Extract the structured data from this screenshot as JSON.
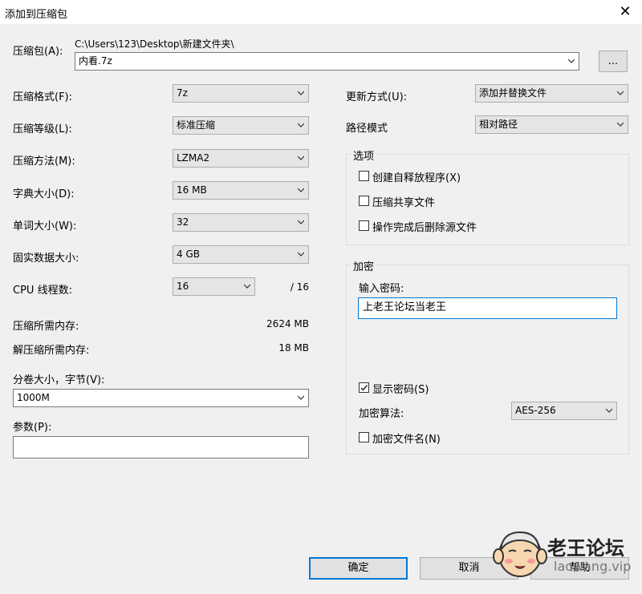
{
  "window": {
    "title": "添加到压缩包",
    "close_glyph": "✕"
  },
  "archive": {
    "label": "压缩包(A):",
    "path": "C:\\Users\\123\\Desktop\\新建文件夹\\",
    "name": "内看.7z",
    "browse_label": "..."
  },
  "left": {
    "format": {
      "label": "压缩格式(F):",
      "value": "7z"
    },
    "level": {
      "label": "压缩等级(L):",
      "value": "标准压缩"
    },
    "method": {
      "label": "压缩方法(M):",
      "value": "LZMA2"
    },
    "dict": {
      "label": "字典大小(D):",
      "value": "16 MB"
    },
    "word": {
      "label": "单词大小(W):",
      "value": "32"
    },
    "solid": {
      "label": "固实数据大小:",
      "value": "4 GB"
    },
    "cpu": {
      "label": "CPU 线程数:",
      "value": "16",
      "total": "/ 16"
    },
    "mem_compress": {
      "label": "压缩所需内存:",
      "value": "2624 MB"
    },
    "mem_decompress": {
      "label": "解压缩所需内存:",
      "value": "18 MB"
    },
    "volume": {
      "label": "分卷大小，字节(V):",
      "value": "1000M"
    },
    "params": {
      "label": "参数(P):",
      "value": ""
    }
  },
  "right": {
    "update": {
      "label": "更新方式(U):",
      "value": "添加并替换文件"
    },
    "path_mode": {
      "label": "路径模式",
      "value": "相对路径"
    },
    "options": {
      "title": "选项",
      "sfx": {
        "label": "创建自释放程序(X)",
        "checked": false
      },
      "shared": {
        "label": "压缩共享文件",
        "checked": false
      },
      "delete": {
        "label": "操作完成后删除源文件",
        "checked": false
      }
    },
    "encryption": {
      "title": "加密",
      "password_label": "输入密码:",
      "password_value": "上老王论坛当老王",
      "show_password": {
        "label": "显示密码(S)",
        "checked": true
      },
      "method_label": "加密算法:",
      "method_value": "AES-256",
      "encrypt_names": {
        "label": "加密文件名(N)",
        "checked": false
      }
    }
  },
  "buttons": {
    "ok": "确定",
    "cancel": "取消",
    "help": "帮助"
  },
  "watermark": {
    "name": "老王论坛",
    "url": "laowang.vip"
  },
  "colors": {
    "accent": "#0078d7",
    "face": "#f0f0f0"
  }
}
